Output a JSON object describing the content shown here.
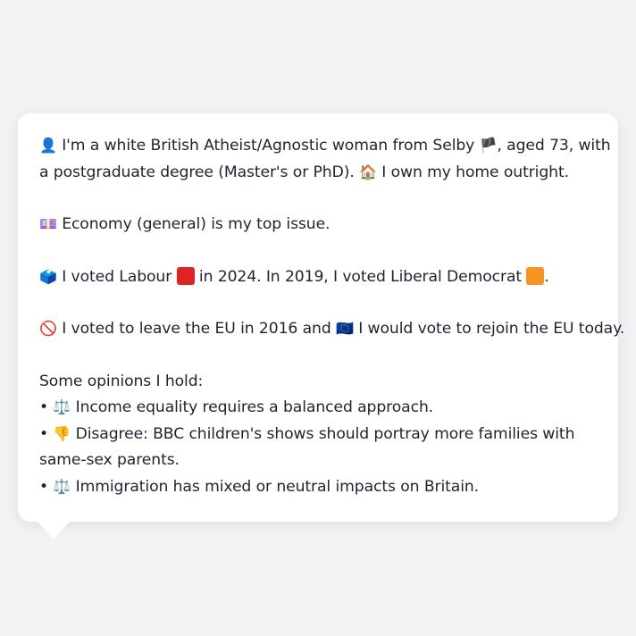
{
  "persona": {
    "intro_line1_pre": "I'm a white British Atheist/Agnostic woman from Selby ",
    "intro_line1_post": ", aged 73, with",
    "intro_line2_pre": "a postgraduate degree (Master's or PhD). ",
    "intro_line2_post": " I own my home outright.",
    "issue_text": " Economy (general) is my top issue.",
    "vote_pre": " I voted Labour ",
    "vote_mid": " in 2024. In 2019, I voted Liberal Democrat ",
    "vote_post": ".",
    "eu_pre": " I voted to leave the EU in 2016 and ",
    "eu_post": " I would vote to rejoin the EU today.",
    "opinions_heading": "Some opinions I hold:",
    "opinions": [
      {
        "bullet": "•",
        "icon": "⚖️",
        "text": " Income equality requires a balanced approach."
      },
      {
        "bullet": "•",
        "icon": "👎",
        "text": " Disagree: BBC children's shows should portray more families with same-sex parents."
      },
      {
        "bullet": "•",
        "icon": "⚖️",
        "text": " Immigration has mixed or neutral impacts on Britain."
      }
    ]
  },
  "icons": {
    "person": "👤",
    "england_flag": "🏴",
    "house": "🏠",
    "economy": "💷",
    "ballot": "🗳️",
    "no_entry": "🚫",
    "eu_flag": "🇪🇺"
  },
  "colors": {
    "labour_red": "#e02424",
    "libdem_orange": "#f7931e",
    "background": "#f1f2f4",
    "card": "#ffffff",
    "text": "#1f2330"
  }
}
